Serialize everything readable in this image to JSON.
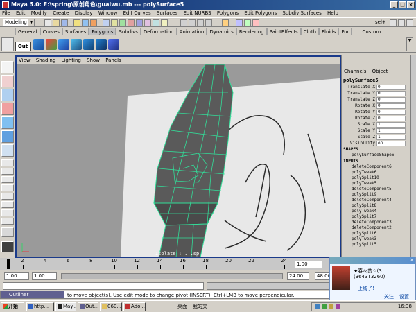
{
  "window": {
    "title": "Maya 5.0: E:\\spring\\原创角色\\guaiwu.mb --- polySurface5"
  },
  "menu": [
    "File",
    "Edit",
    "Modify",
    "Create",
    "Display",
    "Window",
    "Edit Curves",
    "Surfaces",
    "Edit NURBS",
    "Polygons",
    "Edit Polygons",
    "Subdiv Surfaces",
    "Help"
  ],
  "toolbar": {
    "mode": "Modeling",
    "sel_label": "sel+"
  },
  "shelf": {
    "tabs": [
      "General",
      "Curves",
      "Surfaces",
      "Polygons",
      "Subdivs",
      "Deformation",
      "Animation",
      "Dynamics",
      "Rendering",
      "PaintEffects",
      "Cloth",
      "Fluids",
      "Fur"
    ],
    "custom_label": "Custom",
    "active_tab": "Polygons",
    "out_label": "Out"
  },
  "viewport": {
    "menu": [
      "View",
      "Shading",
      "Lighting",
      "Show",
      "Panels"
    ],
    "status_text": "Isolate : ...sp"
  },
  "channel_box": {
    "tabs": [
      "Channels",
      "Object"
    ],
    "object_name": "polySurface5",
    "attributes": [
      {
        "name": "Translate X",
        "value": "0"
      },
      {
        "name": "Translate Y",
        "value": "0"
      },
      {
        "name": "Translate Z",
        "value": "0"
      },
      {
        "name": "Rotate X",
        "value": "0"
      },
      {
        "name": "Rotate Y",
        "value": "0"
      },
      {
        "name": "Rotate Z",
        "value": "0"
      },
      {
        "name": "Scale X",
        "value": "1"
      },
      {
        "name": "Scale Y",
        "value": "1"
      },
      {
        "name": "Scale Z",
        "value": "1"
      },
      {
        "name": "Visibility",
        "value": "on"
      }
    ],
    "shapes_header": "SHAPES",
    "shapes": [
      "polySurfaceShape6"
    ],
    "inputs_header": "INPUTS",
    "inputs": [
      "deleteComponent6",
      "polyTweak6",
      "polySplit10",
      "polyTweak5",
      "deleteComponent5",
      "polySplit9",
      "deleteComponent4",
      "polySplit8",
      "polyTweak4",
      "polySplit7",
      "deleteComponent3",
      "deleteComponent2",
      "polySplit6",
      "polyTweak3",
      "polySplit5"
    ]
  },
  "timeline": {
    "ticks": [
      "2",
      "4",
      "6",
      "8",
      "10",
      "12",
      "14",
      "16",
      "18",
      "20",
      "22",
      "24"
    ],
    "current_frame": "1.00"
  },
  "range": {
    "start": "1.00",
    "start2": "1.00",
    "end": "24.00",
    "end2": "48.00"
  },
  "help_line": "to move object(s). Use edit mode to change pivot (INSERT). Ctrl+LMB to move perpendicular.",
  "outliner_label": "Outliner",
  "taskbar": {
    "start": "开始",
    "tasks": [
      "http...",
      "May...",
      "Out...",
      "060...",
      "Ado..."
    ],
    "tray_label": "桌面",
    "tray_folder": "我的文",
    "clock": "16:38"
  },
  "qq_popup": {
    "name": "★春々韵☆(3...",
    "id": "(3643T3260)",
    "status": "上线了!",
    "link1": "关注",
    "link2": "设置"
  },
  "colors": {
    "wire": "#33dd99",
    "title_blue": "#0a246a",
    "viewport_border": "#1a3a8a"
  }
}
